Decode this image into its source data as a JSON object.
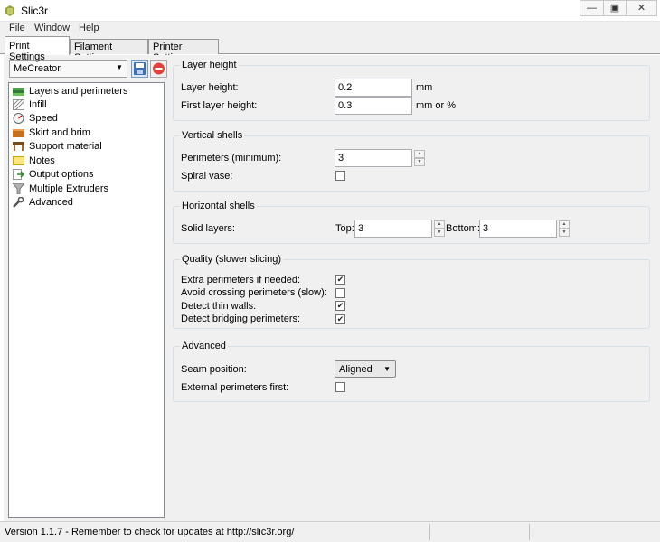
{
  "window": {
    "title": "Slic3r"
  },
  "menu": [
    "File",
    "Window",
    "Help"
  ],
  "tabs": [
    "Print Settings",
    "Filament Settings",
    "Printer Settings"
  ],
  "preset": {
    "selected": "MeCreator"
  },
  "pages": [
    {
      "label": "Layers and perimeters",
      "icon": "layers-icon"
    },
    {
      "label": "Infill",
      "icon": "infill-icon"
    },
    {
      "label": "Speed",
      "icon": "speed-icon"
    },
    {
      "label": "Skirt and brim",
      "icon": "skirt-brim-icon"
    },
    {
      "label": "Support material",
      "icon": "support-material-icon"
    },
    {
      "label": "Notes",
      "icon": "notes-icon"
    },
    {
      "label": "Output options",
      "icon": "output-options-icon"
    },
    {
      "label": "Multiple Extruders",
      "icon": "funnel-icon"
    },
    {
      "label": "Advanced",
      "icon": "wrench-icon"
    }
  ],
  "groups": {
    "layer_height": {
      "title": "Layer height",
      "layer_height": {
        "label": "Layer height:",
        "value": "0.2",
        "units": "mm"
      },
      "first_layer_height": {
        "label": "First layer height:",
        "value": "0.3",
        "units": "mm or %"
      }
    },
    "vertical_shells": {
      "title": "Vertical shells",
      "perimeters": {
        "label": "Perimeters (minimum):",
        "value": "3"
      },
      "spiral_vase": {
        "label": "Spiral vase:",
        "checked": false
      }
    },
    "horizontal_shells": {
      "title": "Horizontal shells",
      "solid_layers": {
        "label": "Solid layers:",
        "top_label": "Top:",
        "top_value": "3",
        "bottom_label": "Bottom:",
        "bottom_value": "3"
      }
    },
    "quality": {
      "title": "Quality (slower slicing)",
      "extra_perimeters": {
        "label": "Extra perimeters if needed:",
        "checked": true
      },
      "avoid_crossing": {
        "label": "Avoid crossing perimeters (slow):",
        "checked": false
      },
      "thin_walls": {
        "label": "Detect thin walls:",
        "checked": true
      },
      "bridging_perimeters": {
        "label": "Detect bridging perimeters:",
        "checked": true
      }
    },
    "advanced": {
      "title": "Advanced",
      "seam_position": {
        "label": "Seam position:",
        "value": "Aligned"
      },
      "external_first": {
        "label": "External perimeters first:",
        "checked": false
      }
    }
  },
  "status": {
    "text": "Version 1.1.7 - Remember to check for updates at http://slic3r.org/"
  }
}
